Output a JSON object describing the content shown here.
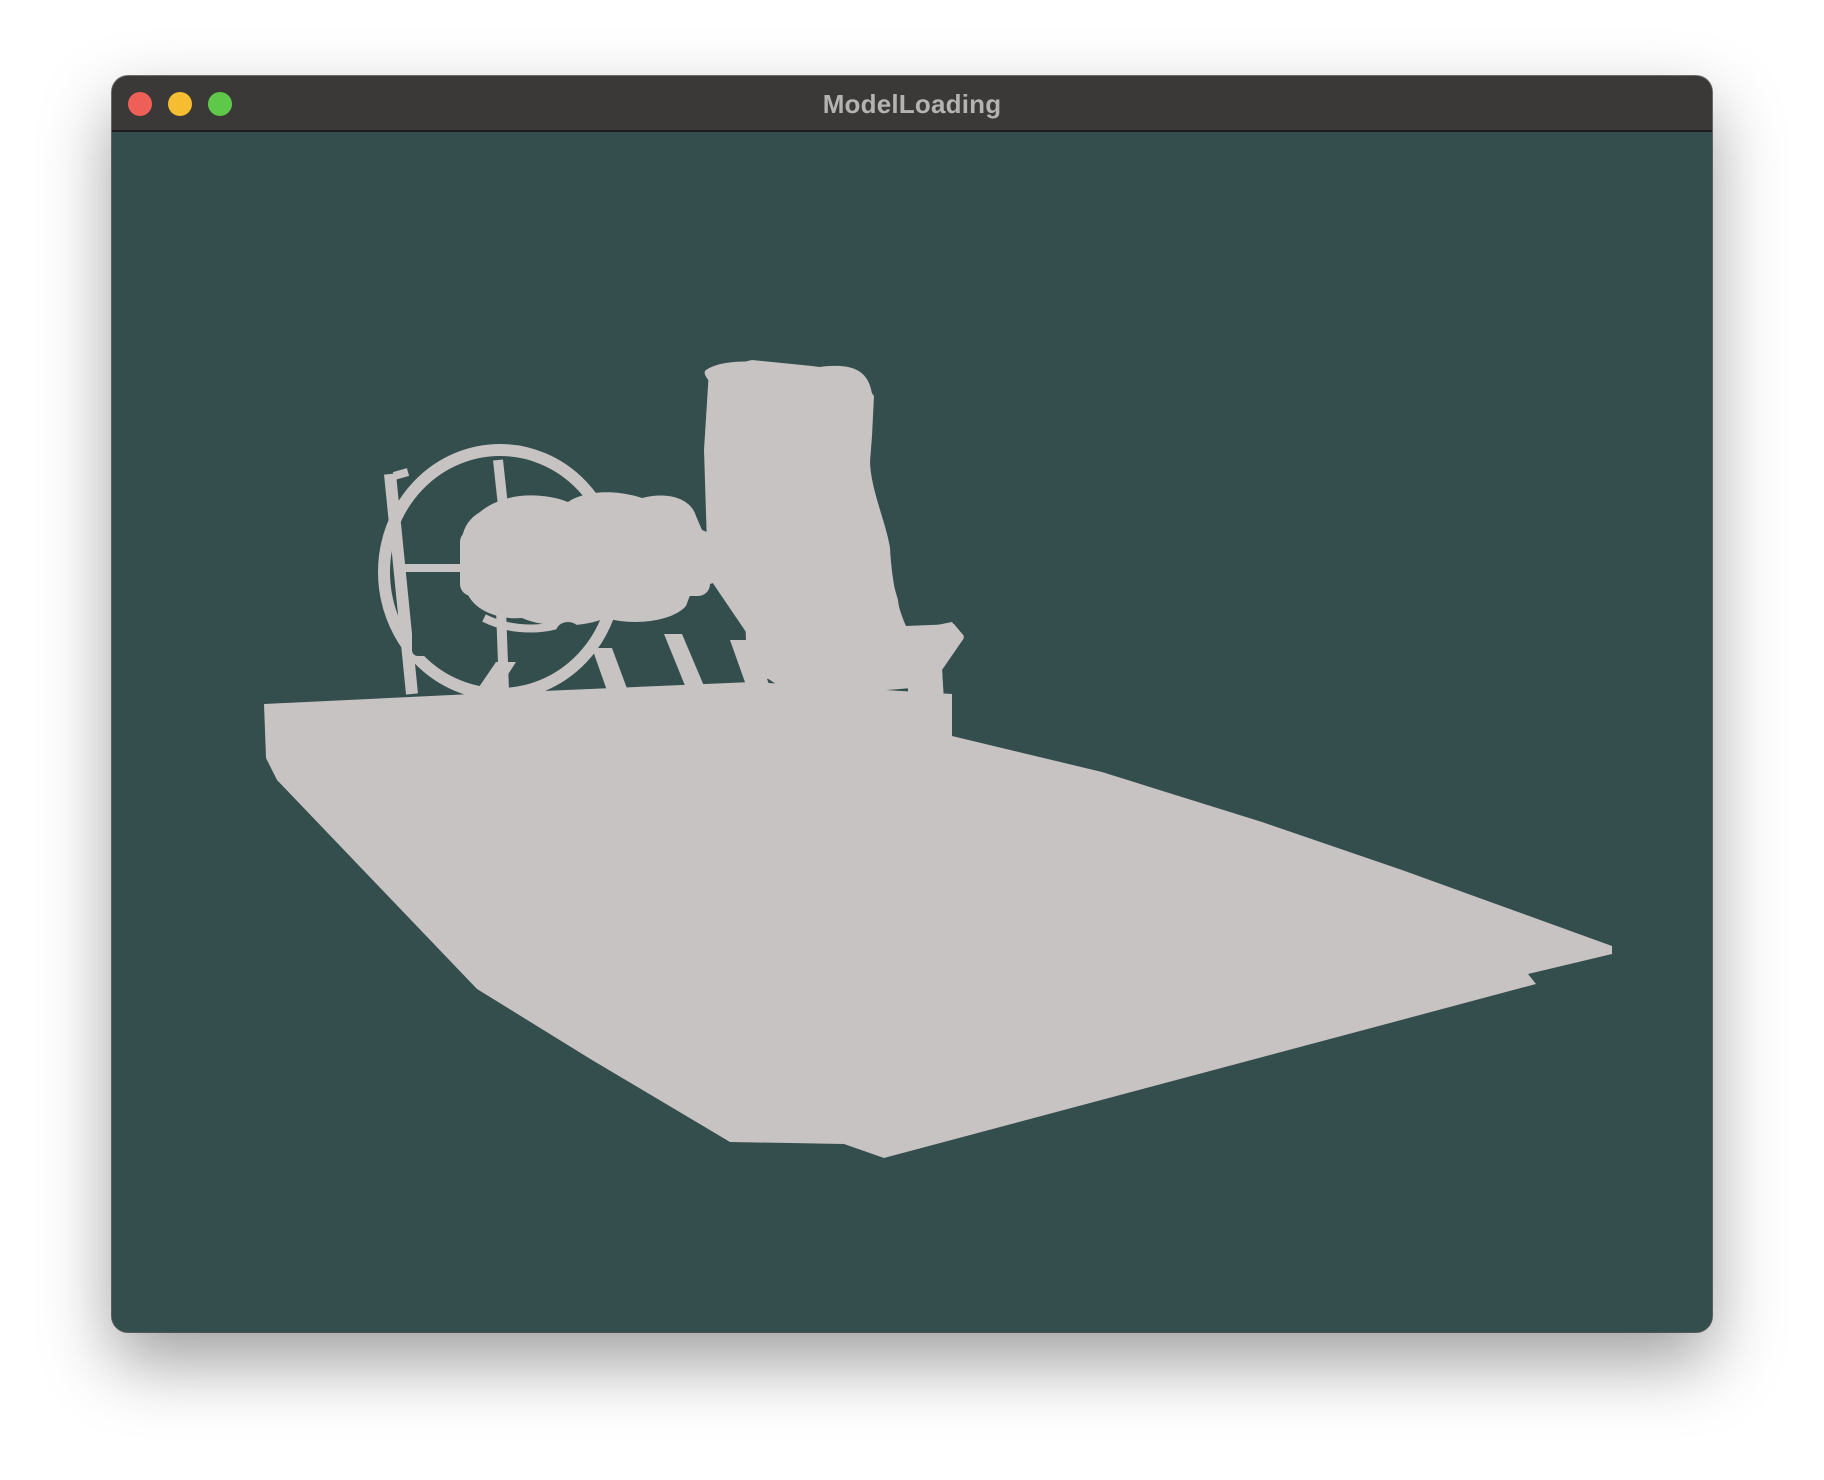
{
  "window": {
    "title": "ModelLoading",
    "traffic_lights": [
      {
        "name": "close",
        "color": "#ee5f58"
      },
      {
        "name": "minimize",
        "color": "#f5bd2f"
      },
      {
        "name": "zoom",
        "color": "#5fc84a"
      }
    ]
  },
  "viewport": {
    "clear_color": "#344d4d",
    "model_color": "#c6c3c2",
    "model": "airboat"
  }
}
